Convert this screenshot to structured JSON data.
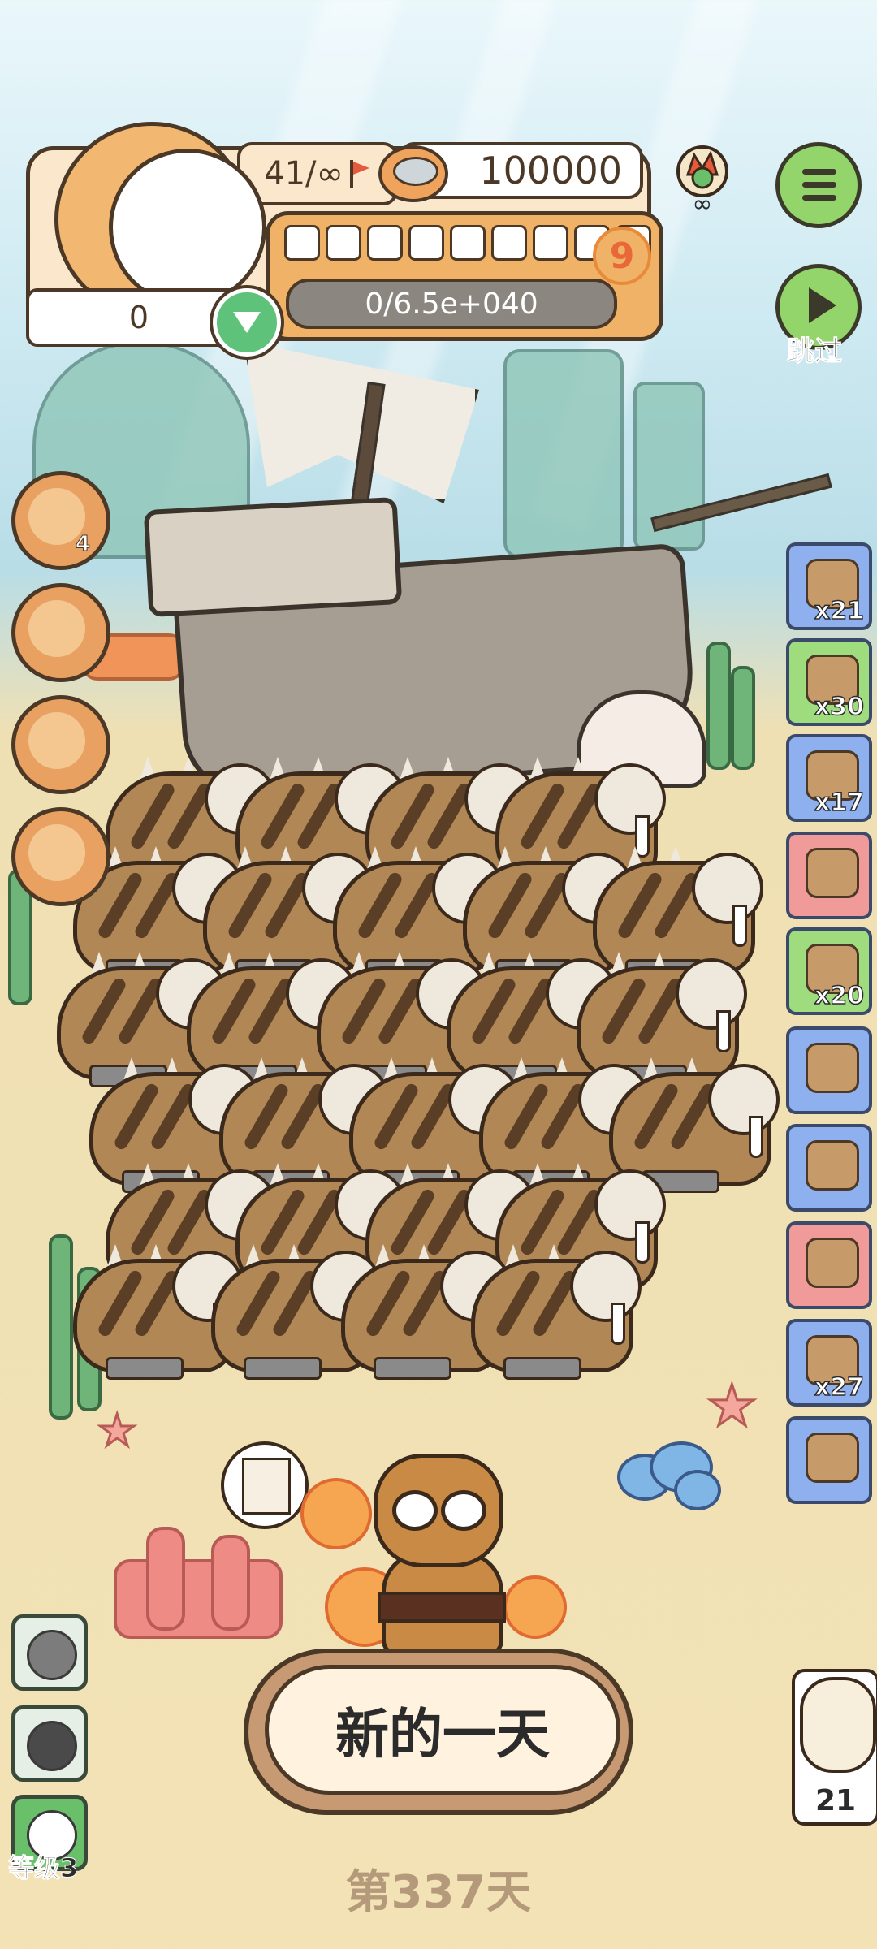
{
  "hud": {
    "level_text": "41/∞",
    "coins": "100000",
    "player_level": "9",
    "xp_text": "0/6.5e+040",
    "gems": "0"
  },
  "top_right": {
    "skip_label": "跳过"
  },
  "left_buttons": [
    {
      "icon": "hourglass-ticket-icon",
      "badge": "4"
    },
    {
      "icon": "phone-icon",
      "badge": ""
    },
    {
      "icon": "box-icon",
      "badge": ""
    },
    {
      "icon": "joystick-icon",
      "badge": ""
    }
  ],
  "inventory": [
    {
      "icon": "scooter-icon",
      "count": "x21",
      "color": "#8fb0ee"
    },
    {
      "icon": "sea-creatures-icon",
      "count": "x30",
      "color": "#9fdc7e"
    },
    {
      "icon": "bag-icon",
      "count": "x17",
      "color": "#8fb0ee"
    },
    {
      "icon": "hanging-tools-icon",
      "count": "",
      "color": "#f09a9a"
    },
    {
      "icon": "tent-icon",
      "count": "x20",
      "color": "#9fdc7e"
    },
    {
      "icon": "hut-icon",
      "count": "",
      "color": "#8fb0ee"
    },
    {
      "icon": "trophy-icon",
      "count": "",
      "color": "#8fb0ee"
    },
    {
      "icon": "pet-bed-icon",
      "count": "",
      "color": "#f09a9a"
    },
    {
      "icon": "sack-icon",
      "count": "x27",
      "color": "#8fb0ee"
    },
    {
      "icon": "sheep-icon",
      "count": "",
      "color": "#8fb0ee"
    }
  ],
  "bottom": {
    "new_day_label": "新的一天",
    "day_label": "第337天",
    "level_label": "等级3",
    "owl_count": "21"
  }
}
